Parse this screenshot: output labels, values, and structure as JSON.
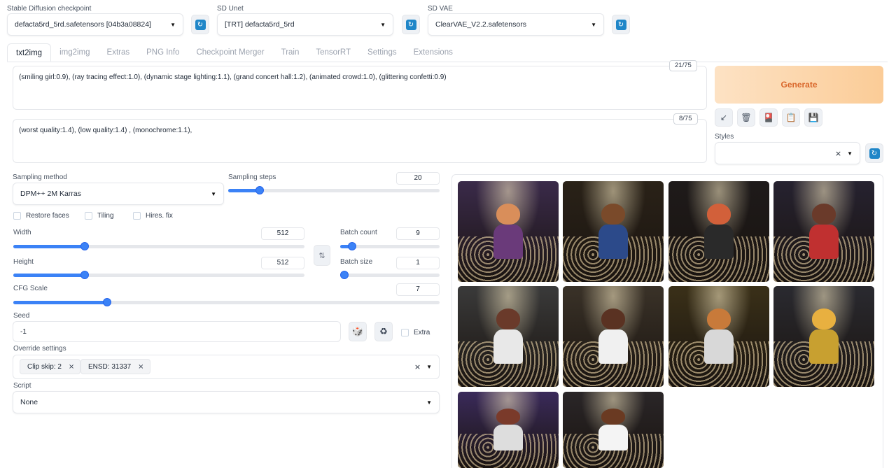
{
  "header": {
    "checkpoint": {
      "label": "Stable Diffusion checkpoint",
      "value": "defacta5rd_5rd.safetensors [04b3a08824]"
    },
    "unet": {
      "label": "SD Unet",
      "value": "[TRT] defacta5rd_5rd"
    },
    "vae": {
      "label": "SD VAE",
      "value": "ClearVAE_V2.2.safetensors"
    },
    "refresh_icon": "↻"
  },
  "tabs": [
    "txt2img",
    "img2img",
    "Extras",
    "PNG Info",
    "Checkpoint Merger",
    "Train",
    "TensorRT",
    "Settings",
    "Extensions"
  ],
  "prompt": {
    "positive": "(smiling girl:0.9), (ray tracing effect:1.0), (dynamic stage lighting:1.1), (grand concert hall:1.2), (animated crowd:1.0), (glittering confetti:0.9)",
    "positive_count": "21/75",
    "negative": "(worst quality:1.4), (low quality:1.4) , (monochrome:1.1),",
    "negative_count": "8/75"
  },
  "actions": {
    "generate": "Generate",
    "tools": [
      {
        "name": "read-params-icon",
        "glyph": "↙"
      },
      {
        "name": "trash-icon",
        "glyph": "🗑"
      },
      {
        "name": "extra-networks-icon",
        "glyph": "🎴"
      },
      {
        "name": "clipboard-icon",
        "glyph": "📋"
      },
      {
        "name": "save-style-icon",
        "glyph": "💾"
      }
    ],
    "styles_label": "Styles",
    "styles_clear": "×"
  },
  "params": {
    "sampling_method": {
      "label": "Sampling method",
      "value": "DPM++ 2M Karras"
    },
    "sampling_steps": {
      "label": "Sampling steps",
      "value": "20",
      "fraction": 0.13
    },
    "checkboxes": [
      "Restore faces",
      "Tiling",
      "Hires. fix"
    ],
    "width": {
      "label": "Width",
      "value": "512",
      "fraction": 0.23
    },
    "height": {
      "label": "Height",
      "value": "512",
      "fraction": 0.23
    },
    "swap_icon": "⇅",
    "batch_count": {
      "label": "Batch count",
      "value": "9",
      "fraction": 0.08
    },
    "batch_size": {
      "label": "Batch size",
      "value": "1",
      "fraction": 0.0
    },
    "cfg_scale": {
      "label": "CFG Scale",
      "value": "7",
      "fraction": 0.21
    },
    "seed": {
      "label": "Seed",
      "value": "-1",
      "dice_icon": "🎲",
      "recycle_icon": "♻",
      "extra_label": "Extra"
    },
    "override": {
      "label": "Override settings",
      "chips": [
        "Clip skip: 2",
        "ENSD: 31337"
      ],
      "clear": "×"
    },
    "script": {
      "label": "Script",
      "value": "None"
    }
  },
  "colors": {
    "accent": "#3b82f6",
    "generate_text": "#d9662a",
    "images": [
      [
        "#3a2a4a",
        "#d98e5a",
        "#6a3a7a"
      ],
      [
        "#2a2218",
        "#7a4a2a",
        "#2c4a8a"
      ],
      [
        "#1e1a1a",
        "#d2603a",
        "#2a2a2a"
      ],
      [
        "#262230",
        "#6a3a2a",
        "#c03030"
      ],
      [
        "#3a3a3a",
        "#6a3a2a",
        "#e8e8e8"
      ],
      [
        "#3a3228",
        "#5a3222",
        "#f0f0f0"
      ],
      [
        "#3a3018",
        "#c87a3a",
        "#d8d8d8"
      ],
      [
        "#2a2a30",
        "#e8b040",
        "#c8a030"
      ],
      [
        "#3a2a5a",
        "#7a3a2a",
        "#ddd"
      ],
      [
        "#2a2628",
        "#6a3a22",
        "#f4f4f4"
      ]
    ]
  }
}
